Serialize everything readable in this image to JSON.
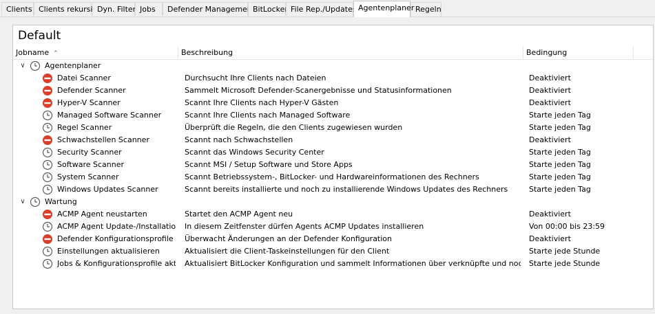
{
  "tabs": [
    {
      "label": "Clients",
      "active": false
    },
    {
      "label": "Clients rekursiv",
      "active": false
    },
    {
      "label": "Dyn. Filter",
      "active": false
    },
    {
      "label": "Jobs",
      "active": false
    },
    {
      "label": "Defender Management",
      "active": false
    },
    {
      "label": "BitLocker",
      "active": false
    },
    {
      "label": "File Rep./Updates",
      "active": false
    },
    {
      "label": "Agentenplaner",
      "active": true
    },
    {
      "label": "Regeln",
      "active": false
    }
  ],
  "panel": {
    "title": "Default",
    "columns": {
      "jobname": "Jobname",
      "beschreibung": "Beschreibung",
      "bedingung": "Bedingung"
    }
  },
  "colors": {
    "disabled_icon": "#d9402b",
    "clock_icon": "#5a5a5a",
    "tab_border": "#d9d9d9"
  },
  "groups": [
    {
      "name": "Agentenplaner",
      "icon": "clock-icon",
      "expanded": true,
      "jobs": [
        {
          "name": "Datei Scanner",
          "desc": "Durchsucht Ihre Clients nach Dateien",
          "cond": "Deaktiviert",
          "icon": "disabled-icon"
        },
        {
          "name": "Defender Scanner",
          "desc": "Sammelt Microsoft Defender-Scanergebnisse und Statusinformationen",
          "cond": "Deaktiviert",
          "icon": "disabled-icon"
        },
        {
          "name": "Hyper-V Scanner",
          "desc": "Scannt Ihre Clients nach Hyper-V Gästen",
          "cond": "Deaktiviert",
          "icon": "disabled-icon"
        },
        {
          "name": "Managed Software Scanner",
          "desc": "Scannt Ihre Clients nach Managed Software",
          "cond": "Starte jeden Tag",
          "icon": "clock-icon"
        },
        {
          "name": "Regel Scanner",
          "desc": "Überprüft die Regeln, die den Clients zugewiesen wurden",
          "cond": "Starte jeden Tag",
          "icon": "clock-icon"
        },
        {
          "name": "Schwachstellen Scanner",
          "desc": "Scannt nach Schwachstellen",
          "cond": "Deaktiviert",
          "icon": "disabled-icon"
        },
        {
          "name": "Security Scanner",
          "desc": "Scannt das Windows Security Center",
          "cond": "Starte jeden Tag",
          "icon": "clock-icon"
        },
        {
          "name": "Software Scanner",
          "desc": "Scannt MSI / Setup Software und Store Apps",
          "cond": "Starte jeden Tag",
          "icon": "clock-icon"
        },
        {
          "name": "System Scanner",
          "desc": "Scannt Betriebssystem-, BitLocker- und Hardwareinformationen des Rechners",
          "cond": "Starte jeden Tag",
          "icon": "clock-icon"
        },
        {
          "name": "Windows Updates Scanner",
          "desc": "Scannt bereits installierte und noch zu installierende Windows Updates des Rechners",
          "cond": "Starte jeden Tag",
          "icon": "clock-icon"
        }
      ]
    },
    {
      "name": "Wartung",
      "icon": "clock-icon",
      "expanded": true,
      "jobs": [
        {
          "name": "ACMP Agent neustarten",
          "desc": "Startet den ACMP Agent neu",
          "cond": "Deaktiviert",
          "icon": "disabled-icon"
        },
        {
          "name": "ACMP Agent Update-/Installation...",
          "desc": "In diesem Zeitfenster dürfen Agents ACMP Updates installieren",
          "cond": "Von 00:00 bis 23:59",
          "icon": "clock-icon"
        },
        {
          "name": "Defender Konfigurationsprofile a...",
          "desc": "Überwacht Änderungen an der Defender Konfiguration",
          "cond": "Deaktiviert",
          "icon": "disabled-icon"
        },
        {
          "name": "Einstellungen aktualisieren",
          "desc": "Aktualisiert die Client-Taskeinstellungen für den Client",
          "cond": "Starte jede Stunde",
          "icon": "clock-icon"
        },
        {
          "name": "Jobs & Konfigurationsprofile aktu...",
          "desc": "Aktualisiert BitLocker Konfiguration und sammelt Informationen über verknüpfte und noch auszufü...",
          "cond": "Starte jede Stunde",
          "icon": "clock-icon"
        }
      ]
    }
  ]
}
